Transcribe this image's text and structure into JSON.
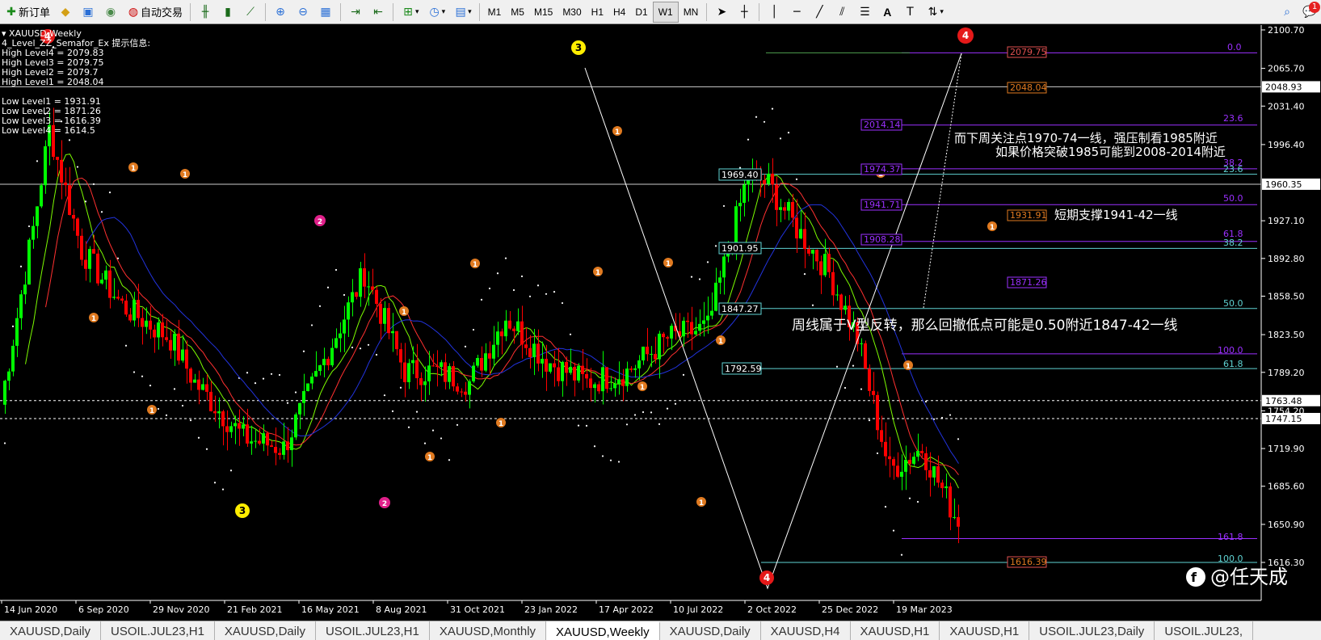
{
  "toolbar": {
    "new_order": "新订单",
    "auto_trading": "自动交易",
    "timeframes": [
      "M1",
      "M5",
      "M15",
      "M30",
      "H1",
      "H4",
      "D1",
      "W1",
      "MN"
    ],
    "alert_count": "1"
  },
  "chart": {
    "title": "XAUUSD,Weekly",
    "indicator_info": [
      "4_Level_ZZ_Semafor_Ex 提示信息:",
      "High Level4 = 2079.83",
      "High Level3 = 2079.75",
      "High Level2 = 2079.7",
      "High Level1 = 2048.04",
      "",
      "Low Level1 = 1931.91",
      "Low Level2 = 1871.26",
      "Low Level3 = 1616.39",
      "Low Level4 = 1614.5"
    ],
    "annotations": [
      "而下周关注点1970-74一线，强压制看1985附近",
      "如果价格突破1985可能到2008-2014附近",
      "短期支撑1941-42一线",
      "周线属于V型反转，那么回撤低点可能是0.50附近1847-42一线"
    ],
    "fib_boxes": [
      "1969.40",
      "1901.95",
      "1847.27",
      "1792.59"
    ],
    "fib_ratios_right": [
      "0.0",
      "23.6",
      "38.2",
      "23.6",
      "50.0",
      "61.8",
      "38.2",
      "50.0",
      "100.0",
      "61.8",
      "161.8",
      "100.0"
    ],
    "price_tags": [
      "2079.75",
      "2048.04",
      "2014.14",
      "1974.37",
      "1941.71",
      "1908.28",
      "1931.91",
      "1871.26",
      "1616.39"
    ],
    "watermark": "@任天成",
    "semafor_labels": [
      "1",
      "2",
      "3",
      "4"
    ]
  },
  "price_axis": {
    "levels": [
      "2100.70",
      "2065.70",
      "2031.40",
      "1996.40",
      "1927.10",
      "1892.80",
      "1858.50",
      "1823.50",
      "1789.20",
      "1754.20",
      "1719.90",
      "1685.60",
      "1650.90",
      "1616.30"
    ],
    "current_price": "1960.35",
    "highlight_prices": [
      "2048.93",
      "1763.48",
      "1747.15"
    ]
  },
  "time_axis": {
    "dates": [
      "14 Jun 2020",
      "6 Sep 2020",
      "29 Nov 2020",
      "21 Feb 2021",
      "16 May 2021",
      "8 Aug 2021",
      "31 Oct 2021",
      "23 Jan 2022",
      "17 Apr 2022",
      "10 Jul 2022",
      "2 Oct 2022",
      "25 Dec 2022",
      "19 Mar 2023"
    ]
  },
  "tabs": [
    "XAUUSD,Daily",
    "USOIL.JUL23,H1",
    "XAUUSD,Daily",
    "USOIL.JUL23,H1",
    "XAUUSD,Monthly",
    "XAUUSD,Weekly",
    "XAUUSD,Daily",
    "XAUUSD,H4",
    "XAUUSD,H1",
    "XAUUSD,H1",
    "USOIL.JUL23,Daily",
    "USOIL.JUL23,"
  ],
  "active_tab_index": 5,
  "colors": {
    "bull": "#00ff00",
    "bear": "#ff0000",
    "ma_fast": "#7cfc00",
    "ma_mid": "#ff3030",
    "ma_slow": "#2233dd",
    "fib_cyan": "#5fd3d3",
    "fib_purple": "#9b30ff",
    "semafor_orange": "#e07a20",
    "semafor_magenta": "#e0208a",
    "semafor_yellow": "#ffee00",
    "semafor_red": "#e51919"
  }
}
